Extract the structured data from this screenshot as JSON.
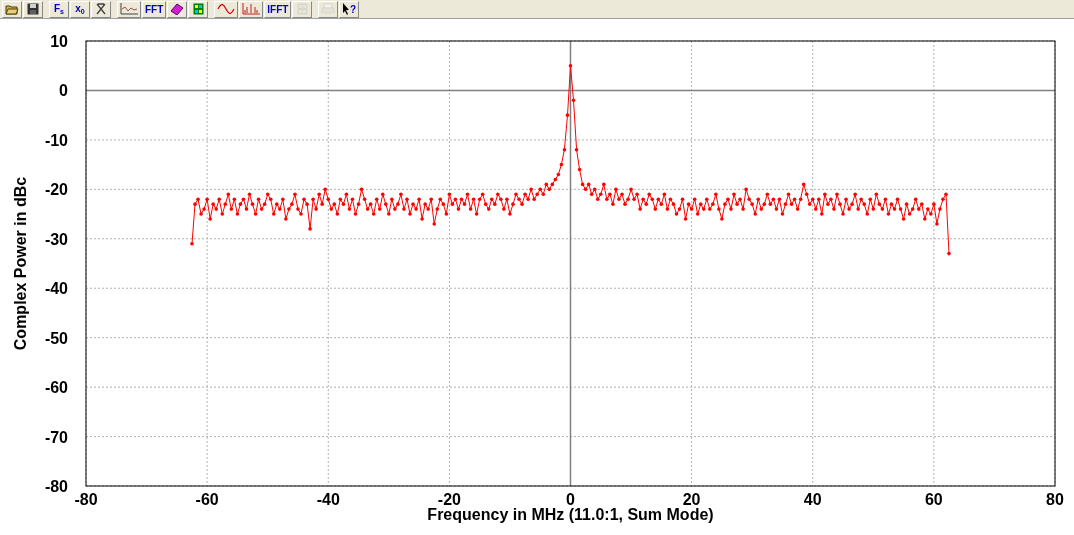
{
  "toolbar": [
    {
      "kind": "open",
      "disabled": false
    },
    {
      "kind": "save",
      "disabled": false
    },
    {
      "kind": "text",
      "label": "F",
      "sub": "s",
      "disabled": false
    },
    {
      "kind": "text",
      "label": "x",
      "sub": "0",
      "disabled": false
    },
    {
      "kind": "clear",
      "disabled": false
    },
    {
      "kind": "plot",
      "disabled": false
    },
    {
      "kind": "text",
      "label": "FFT",
      "disabled": false
    },
    {
      "kind": "eraser",
      "disabled": false
    },
    {
      "kind": "grid",
      "disabled": false
    },
    {
      "kind": "sine",
      "disabled": false
    },
    {
      "kind": "spectrum",
      "disabled": false
    },
    {
      "kind": "text",
      "label": "IFFT",
      "disabled": false
    },
    {
      "kind": "grid",
      "disabled": true
    },
    {
      "kind": "print",
      "disabled": true
    },
    {
      "kind": "help",
      "label": "?",
      "disabled": false
    }
  ],
  "chart": {
    "chart_data": {
      "type": "line",
      "grid": true,
      "xlabel": "Frequency in MHz (11.0:1, Sum Mode)",
      "ylabel": "Complex Power in dBc",
      "xlim": [
        -80,
        80
      ],
      "ylim": [
        -80,
        10
      ],
      "xticks": [
        -80,
        -60,
        -40,
        -20,
        0,
        20,
        40,
        60,
        80
      ],
      "yticks": [
        10,
        0,
        -10,
        -20,
        -30,
        -40,
        -50,
        -60,
        -70,
        -80
      ],
      "x": [
        -62.5,
        -62,
        -61.5,
        -61,
        -60.5,
        -60,
        -59.5,
        -59,
        -58.5,
        -58,
        -57.5,
        -57,
        -56.5,
        -56,
        -55.5,
        -55,
        -54.5,
        -54,
        -53.5,
        -53,
        -52.5,
        -52,
        -51.5,
        -51,
        -50.5,
        -50,
        -49.5,
        -49,
        -48.5,
        -48,
        -47.5,
        -47,
        -46.5,
        -46,
        -45.5,
        -45,
        -44.5,
        -44,
        -43.5,
        -43,
        -42.5,
        -42,
        -41.5,
        -41,
        -40.5,
        -40,
        -39.5,
        -39,
        -38.5,
        -38,
        -37.5,
        -37,
        -36.5,
        -36,
        -35.5,
        -35,
        -34.5,
        -34,
        -33.5,
        -33,
        -32.5,
        -32,
        -31.5,
        -31,
        -30.5,
        -30,
        -29.5,
        -29,
        -28.5,
        -28,
        -27.5,
        -27,
        -26.5,
        -26,
        -25.5,
        -25,
        -24.5,
        -24,
        -23.5,
        -23,
        -22.5,
        -22,
        -21.5,
        -21,
        -20.5,
        -20,
        -19.5,
        -19,
        -18.5,
        -18,
        -17.5,
        -17,
        -16.5,
        -16,
        -15.5,
        -15,
        -14.5,
        -14,
        -13.5,
        -13,
        -12.5,
        -12,
        -11.5,
        -11,
        -10.5,
        -10,
        -9.5,
        -9,
        -8.5,
        -8,
        -7.5,
        -7,
        -6.5,
        -6,
        -5.5,
        -5,
        -4.5,
        -4,
        -3.5,
        -3,
        -2.5,
        -2,
        -1.5,
        -1,
        -0.5,
        0,
        0.5,
        1,
        1.5,
        2,
        2.5,
        3,
        3.5,
        4,
        4.5,
        5,
        5.5,
        6,
        6.5,
        7,
        7.5,
        8,
        8.5,
        9,
        9.5,
        10,
        10.5,
        11,
        11.5,
        12,
        12.5,
        13,
        13.5,
        14,
        14.5,
        15,
        15.5,
        16,
        16.5,
        17,
        17.5,
        18,
        18.5,
        19,
        19.5,
        20,
        20.5,
        21,
        21.5,
        22,
        22.5,
        23,
        23.5,
        24,
        24.5,
        25,
        25.5,
        26,
        26.5,
        27,
        27.5,
        28,
        28.5,
        29,
        29.5,
        30,
        30.5,
        31,
        31.5,
        32,
        32.5,
        33,
        33.5,
        34,
        34.5,
        35,
        35.5,
        36,
        36.5,
        37,
        37.5,
        38,
        38.5,
        39,
        39.5,
        40,
        40.5,
        41,
        41.5,
        42,
        42.5,
        43,
        43.5,
        44,
        44.5,
        45,
        45.5,
        46,
        46.5,
        47,
        47.5,
        48,
        48.5,
        49,
        49.5,
        50,
        50.5,
        51,
        51.5,
        52,
        52.5,
        53,
        53.5,
        54,
        54.5,
        55,
        55.5,
        56,
        56.5,
        57,
        57.5,
        58,
        58.5,
        59,
        59.5,
        60,
        60.5,
        61,
        61.5,
        62,
        62.5
      ],
      "series": [
        {
          "color": "#ff0000",
          "values": [
            -31,
            -23,
            -22,
            -25,
            -24,
            -22,
            -26,
            -23,
            -24,
            -22,
            -25,
            -23,
            -21,
            -24,
            -22,
            -25,
            -23,
            -22,
            -24,
            -21,
            -23,
            -25,
            -22,
            -24,
            -23,
            -21,
            -22,
            -25,
            -23,
            -24,
            -22,
            -26,
            -24,
            -23,
            -21,
            -24,
            -25,
            -22,
            -23,
            -28,
            -22,
            -24,
            -21,
            -23,
            -20,
            -22,
            -24,
            -23,
            -25,
            -22,
            -23,
            -21,
            -24,
            -22,
            -25,
            -23,
            -20,
            -22,
            -24,
            -23,
            -25,
            -22,
            -24,
            -21,
            -23,
            -25,
            -22,
            -24,
            -23,
            -21,
            -24,
            -22,
            -25,
            -23,
            -24,
            -22,
            -26,
            -23,
            -24,
            -22,
            -27,
            -24,
            -22,
            -23,
            -25,
            -21,
            -23,
            -22,
            -24,
            -22,
            -23,
            -21,
            -24,
            -22,
            -25,
            -22,
            -21,
            -23,
            -24,
            -22,
            -23,
            -21,
            -22,
            -24,
            -22,
            -25,
            -23,
            -21,
            -22,
            -23,
            -21,
            -22,
            -20,
            -22,
            -21,
            -20,
            -21,
            -19,
            -20,
            -19,
            -18,
            -17,
            -15,
            -12,
            -5,
            5,
            -2,
            -12,
            -16,
            -19,
            -20,
            -19,
            -21,
            -20,
            -22,
            -21,
            -19,
            -22,
            -21,
            -23,
            -20,
            -22,
            -21,
            -23,
            -22,
            -20,
            -22,
            -21,
            -24,
            -22,
            -23,
            -21,
            -22,
            -24,
            -22,
            -23,
            -21,
            -24,
            -22,
            -23,
            -25,
            -24,
            -22,
            -26,
            -23,
            -24,
            -22,
            -25,
            -23,
            -24,
            -22,
            -24,
            -23,
            -21,
            -24,
            -26,
            -23,
            -22,
            -24,
            -21,
            -23,
            -22,
            -24,
            -20,
            -22,
            -23,
            -25,
            -22,
            -24,
            -23,
            -21,
            -23,
            -22,
            -24,
            -22,
            -25,
            -23,
            -21,
            -23,
            -22,
            -24,
            -22,
            -19,
            -21,
            -23,
            -22,
            -24,
            -22,
            -25,
            -21,
            -23,
            -22,
            -24,
            -21,
            -23,
            -25,
            -22,
            -24,
            -23,
            -21,
            -24,
            -22,
            -23,
            -25,
            -22,
            -24,
            -21,
            -23,
            -24,
            -22,
            -25,
            -23,
            -24,
            -22,
            -24,
            -26,
            -23,
            -25,
            -24,
            -22,
            -24,
            -23,
            -26,
            -24,
            -25,
            -23,
            -27,
            -24,
            -22,
            -21,
            -33
          ]
        }
      ]
    }
  }
}
